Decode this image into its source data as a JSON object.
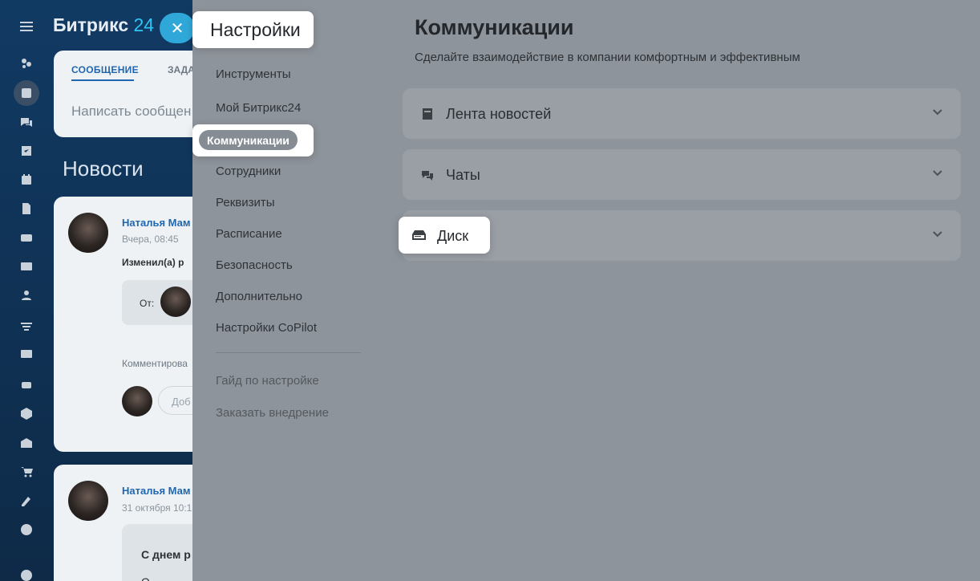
{
  "background": {
    "brand": {
      "name": "Битрикс",
      "number": "24"
    },
    "composer": {
      "tab_message": "СООБЩЕНИЕ",
      "tab_task_partial": "ЗАДА",
      "write_placeholder": "Написать сообщен"
    },
    "news_title": "Новости",
    "posts": [
      {
        "author": "Наталья Мам",
        "time": "Вчера, 08:45",
        "action": "Изменил(а) р",
        "from_label": "От:",
        "comment_label": "Комментирова",
        "add_placeholder": "Доб"
      },
      {
        "author": "Наталья Мам",
        "time": "31 октября 10:1",
        "body_heading": "С днем р",
        "body_partial": "О"
      }
    ]
  },
  "settings_nav": {
    "title": "Настройки",
    "items": [
      {
        "label": "Инструменты"
      },
      {
        "label": "Мой Битрикс24"
      },
      {
        "label": "Коммуникации",
        "active": true
      },
      {
        "label": "Сотрудники"
      },
      {
        "label": "Реквизиты"
      },
      {
        "label": "Расписание"
      },
      {
        "label": "Безопасность"
      },
      {
        "label": "Дополнительно"
      },
      {
        "label": "Настройки CoPilot"
      }
    ],
    "footer_links": [
      {
        "label": "Гайд по настройке"
      },
      {
        "label": "Заказать внедрение"
      }
    ]
  },
  "content": {
    "title": "Коммуникации",
    "subtitle": "Сделайте взаимодействие в компании комфортным и эффективным",
    "sections": [
      {
        "label": "Лента новостей",
        "icon": "news-feed-icon"
      },
      {
        "label": "Чаты",
        "icon": "chats-icon"
      },
      {
        "label": "Диск",
        "icon": "disk-icon"
      }
    ]
  },
  "colors": {
    "accent": "#2fc6f6",
    "link": "#2067b0",
    "overlay": "#8e949b",
    "callout": "#ffffff"
  }
}
